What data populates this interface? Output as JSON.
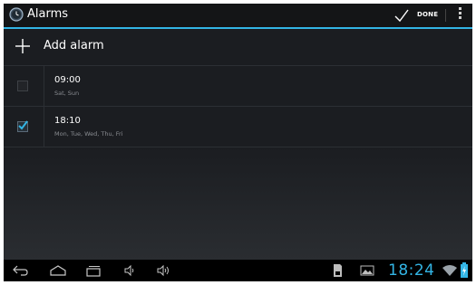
{
  "action_bar": {
    "title": "Alarms",
    "done_label": "DONE",
    "icons": [
      "clock-app-icon",
      "check-icon",
      "overflow-menu-icon"
    ]
  },
  "add_alarm": {
    "label": "Add alarm",
    "icon": "plus-icon"
  },
  "alarms": [
    {
      "time": "09:00",
      "days": "Sat, Sun",
      "checked": false
    },
    {
      "time": "18:10",
      "days": "Mon, Tue, Wed, Thu, Fri",
      "checked": true
    }
  ],
  "status_bar": {
    "clock": "18:24",
    "icons": [
      "back-icon",
      "home-icon",
      "recent-apps-icon",
      "volume-down-icon",
      "volume-up-icon",
      "sd-card-icon",
      "gallery-icon",
      "wifi-icon",
      "battery-charging-icon"
    ]
  },
  "colors": {
    "accent": "#33b5e5",
    "background": "#1b1d21",
    "action_bar": "#141517"
  }
}
